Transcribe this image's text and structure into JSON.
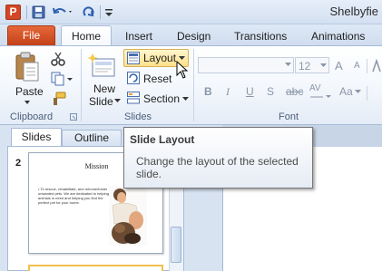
{
  "window": {
    "title": "Shelbyfie"
  },
  "qat": {
    "icons": [
      "powerpoint-icon",
      "save-icon",
      "undo-icon",
      "redo-icon",
      "customize-icon"
    ]
  },
  "tabs": {
    "file": "File",
    "items": [
      "Home",
      "Insert",
      "Design",
      "Transitions",
      "Animations"
    ],
    "active": "Home"
  },
  "ribbon": {
    "clipboard": {
      "paste": "Paste",
      "group_label": "Clipboard"
    },
    "slides": {
      "new_slide_line1": "New",
      "new_slide_line2": "Slide",
      "layout": "Layout",
      "reset": "Reset",
      "section": "Section",
      "group_label": "Slides"
    },
    "font": {
      "size": "12",
      "group_label": "Font",
      "bold": "B",
      "italic": "I",
      "underline": "U",
      "shadow": "S",
      "strike": "abc",
      "spacing": "AV",
      "case": "Aa",
      "grow": "A",
      "shrink": "A"
    }
  },
  "pane": {
    "tabs": [
      "Slides",
      "Outline"
    ],
    "slide_number": "2",
    "slide_title": "Mission",
    "slide_text": "• To rescue, rehabilitate, and rehome/foster unwanted pets. We are dedicated to helping animals in need and helping you find the perfect pet for your home."
  },
  "tooltip": {
    "title": "Slide Layout",
    "body": "Change the layout of the selected slide."
  },
  "colors": {
    "file_tab": "#d24726",
    "accent": "#ffe08a",
    "ribbon_border": "#a7bbd6"
  }
}
